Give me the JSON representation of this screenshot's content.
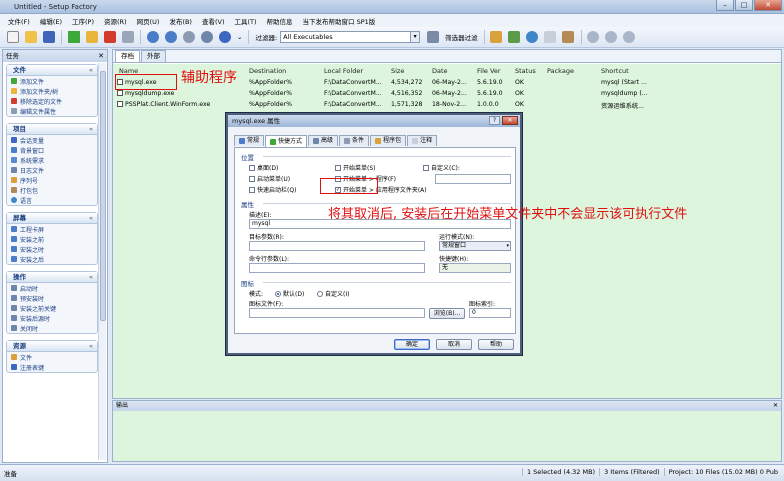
{
  "window": {
    "title": "Untitled - Setup Factory",
    "min": "–",
    "max": "□",
    "close": "✕"
  },
  "menu": [
    "文件(F)",
    "编辑(E)",
    "工序(P)",
    "资源(R)",
    "网页(U)",
    "发布(B)",
    "查看(V)",
    "工具(T)",
    "帮助信息",
    "当下发布帮助窗口 SP1版"
  ],
  "toolbar": {
    "filter_label": "过滤器:",
    "filter_value": "All Executables",
    "filter_action": "筛选器过滤",
    "dots": "⌄"
  },
  "sidebar": {
    "title": "任务",
    "groups": [
      {
        "title": "文件",
        "items": [
          "添加文件",
          "添加文件夹/树",
          "移除选定的文件",
          "编辑文件属性"
        ]
      },
      {
        "title": "项目",
        "items": [
          "会话变量",
          "背景窗口",
          "系统需求",
          "日志文件",
          "序列号",
          "打包包",
          "语言"
        ]
      },
      {
        "title": "屏幕",
        "items": [
          "工程卡屏",
          "安装之前",
          "安装之时",
          "安装之后"
        ]
      },
      {
        "title": "操作",
        "items": [
          "启动时",
          "预安装时",
          "安装之前关键",
          "安装后源时",
          "关闭时"
        ]
      },
      {
        "title": "资源",
        "items": [
          "文件",
          "注册表键"
        ]
      }
    ]
  },
  "tabs": {
    "archive": "存档",
    "external": "外部"
  },
  "file_table": {
    "columns": [
      "Name",
      "Destination",
      "Local Folder",
      "Size",
      "Date",
      "File Ver",
      "Status",
      "Package",
      "Shortcut"
    ],
    "rows": [
      [
        "mysql.exe",
        "%AppFolder%",
        "F:\\DataConvertM...",
        "4,534,272",
        "06-May-2...",
        "5.6.19.0",
        "OK",
        "",
        "mysql (Start ..."
      ],
      [
        "mysqldump.exe",
        "%AppFolder%",
        "F:\\DataConvertM...",
        "4,516,352",
        "06-May-2...",
        "5.6.19.0",
        "OK",
        "",
        "mysqldump (..."
      ],
      [
        "PSSPlat.Client.WinForm.exe",
        "%AppFolder%",
        "F:\\DataConvertM...",
        "1,571,328",
        "18-Nov-2...",
        "1.0.0.0",
        "OK",
        "",
        "资源运维系统..."
      ]
    ]
  },
  "annotations": {
    "helper": "辅助程序",
    "note": "将其取消后, 安装后在开始菜单文件夹中不会显示该可执行文件"
  },
  "dialog": {
    "title": "mysql.exe 属性",
    "help": "?",
    "close": "✕",
    "tabs": [
      "常规",
      "快捷方式",
      "高级",
      "条件",
      "程序包",
      "注释"
    ],
    "section_location": "位置",
    "locations": [
      {
        "label": "桌面(D)",
        "checked": false
      },
      {
        "label": "开始菜单(S)",
        "checked": false
      },
      {
        "label": "自定义(C):",
        "checked": false
      },
      {
        "label": "启动菜单(U)",
        "checked": false
      },
      {
        "label": "开始菜单 > 程序(F)",
        "checked": false
      },
      {
        "label": "快速启动栏(Q)",
        "checked": false
      },
      {
        "label": "开始菜单 > 应用程序文件夹(A)",
        "checked": true
      }
    ],
    "section_props": "属性",
    "desc_label": "描述(E):",
    "desc_value": "mysql",
    "target_label": "目标参数(R):",
    "start_label": "运行模式(N):",
    "start_value": "常规窗口",
    "cmd_label": "命令行参数(L):",
    "hotkey_label": "快捷键(H):",
    "hotkey_value": "无",
    "section_icon": "图标",
    "icon_mode_label": "模式:",
    "icon_default": "默认(D)",
    "icon_custom": "自定义(I)",
    "icon_file_label": "图标文件(F):",
    "icon_index_label": "图标索引:",
    "browse": "浏览(B)...",
    "index_value": "0",
    "ok": "确定",
    "cancel": "取消",
    "help_btn": "帮助"
  },
  "output": {
    "title": "输出",
    "pin": "✕"
  },
  "status": {
    "left": "准备",
    "selected": "1 Selected (4.32 MB)",
    "items": "3 Items (Filtered)",
    "project": "Project: 10 Files (15.02 MB) 0 Pub"
  }
}
